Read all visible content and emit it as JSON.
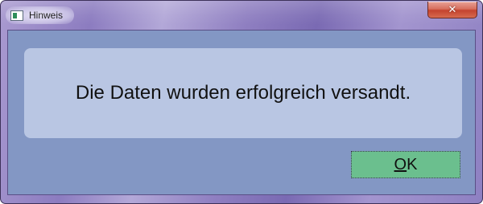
{
  "window": {
    "title": "Hinweis",
    "close_glyph": "✕",
    "app_icon": "window-app-icon",
    "close_color": "#c4432e"
  },
  "message": {
    "text": "Die Daten wurden erfolgreich versandt."
  },
  "buttons": {
    "ok": {
      "mnemonic": "O",
      "rest": "K",
      "color": "#6bbf8e"
    }
  }
}
